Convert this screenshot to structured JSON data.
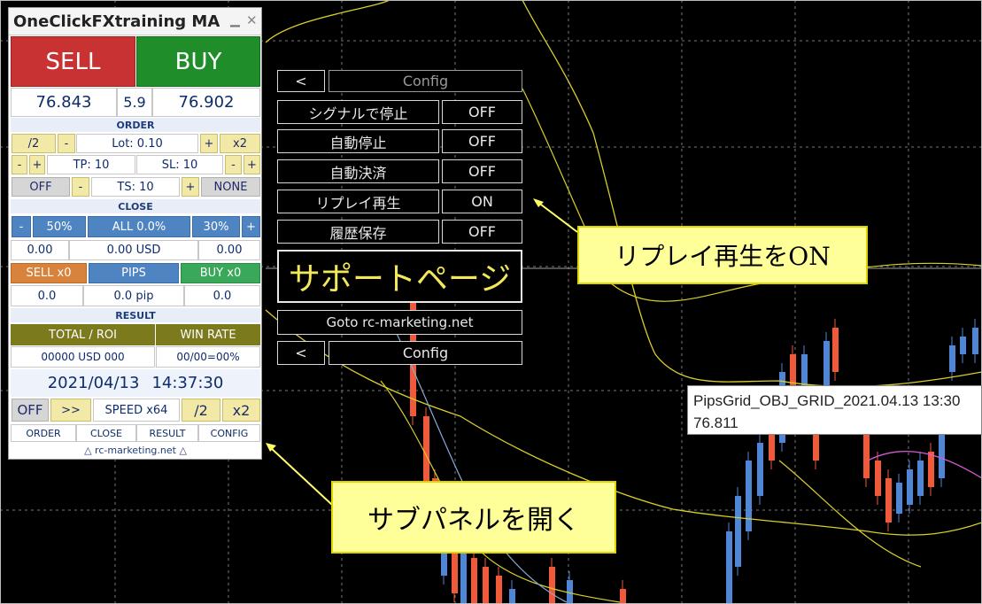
{
  "panel": {
    "title": "OneClickFXtraining MA",
    "minimize_icon": "minimize-icon",
    "close_icon": "close-icon",
    "sell_label": "SELL",
    "buy_label": "BUY",
    "bid": "76.843",
    "spread": "5.9",
    "ask": "76.902",
    "order_header": "ORDER",
    "half_label": "/2",
    "lot_minus": "-",
    "lot_text": "Lot: 0.10",
    "lot_plus": "+",
    "double_label": "x2",
    "tp_minus": "-",
    "tp_plus": "+",
    "tp_text": "TP: 10",
    "sl_text": "SL: 10",
    "sl_minus": "-",
    "sl_plus": "+",
    "ts_off": "OFF",
    "ts_minus": "-",
    "ts_text": "TS: 10",
    "ts_plus": "+",
    "ts_none": "NONE",
    "close_header": "CLOSE",
    "close_minus": "-",
    "close_50": "50%",
    "close_all": "ALL 0.0%",
    "close_30": "30%",
    "close_plus": "+",
    "sell_pl": "0.00",
    "total_pl": "0.00 USD",
    "buy_pl": "0.00",
    "sell_count": "SELL x0",
    "pips_label": "PIPS",
    "buy_count": "BUY x0",
    "sell_pips": "0.0",
    "total_pips": "0.0 pip",
    "buy_pips": "0.0",
    "result_header": "RESULT",
    "total_roi": "TOTAL / ROI",
    "win_rate": "WIN RATE",
    "total_value": "00000 USD 000",
    "winrate_value": "00/00=00%",
    "date": "2021/04/13",
    "time": "14:37:30",
    "replay_off": "OFF",
    "replay_ff": ">>",
    "speed": "SPEED x64",
    "speed_half": "/2",
    "speed_double": "x2",
    "tabs": [
      "ORDER",
      "CLOSE",
      "RESULT",
      "CONFIG"
    ],
    "footer": "△ rc-marketing.net △"
  },
  "subpanel": {
    "back_icon": "<",
    "header": "Config",
    "rows": [
      {
        "label": "シグナルで停止",
        "value": "OFF"
      },
      {
        "label": "自動停止",
        "value": "OFF"
      },
      {
        "label": "自動決済",
        "value": "OFF"
      },
      {
        "label": "リプレイ再生",
        "value": "ON"
      },
      {
        "label": "履歴保存",
        "value": "OFF"
      }
    ],
    "support_page": "サポートページ",
    "goto": "Goto rc-marketing.net",
    "footer_back": "<",
    "footer": "Config"
  },
  "callouts": {
    "replay_on": "リプレイ再生をON",
    "open_subpanel": "サブパネルを開く"
  },
  "tooltip": {
    "object_name": "PipsGrid_OBJ_GRID_2021.04.13 13:30",
    "price": "76.811"
  },
  "colors": {
    "sell": "#c83232",
    "buy": "#1f8e2a",
    "olive": "#7b7a1c",
    "accent_blue": "#4f84c2",
    "sell_count_bg": "#d9823b",
    "buy_count_bg": "#3aa859",
    "up_candle": "#4f86d6",
    "down_candle": "#f05a3a",
    "bands": "#d9cf2b"
  }
}
